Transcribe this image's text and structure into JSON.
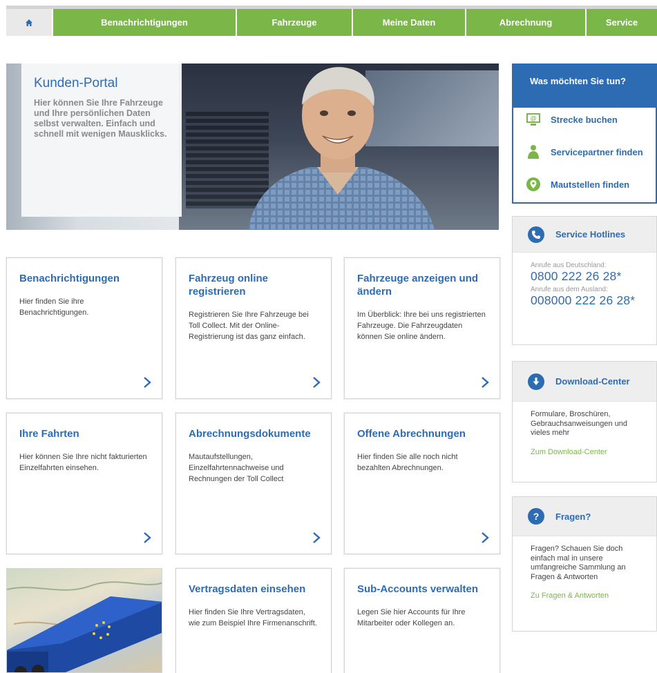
{
  "nav": {
    "items": [
      "Benachrichtigungen",
      "Fahrzeuge",
      "Meine Daten",
      "Abrechnung",
      "Service"
    ]
  },
  "hero": {
    "title": "Kunden-Portal",
    "text": "Hier können Sie Ihre Fahrzeuge und Ihre persönlichen Daten selbst verwalten. Einfach und schnell mit wenigen Mausklicks."
  },
  "tiles": [
    {
      "title": "Benachrichtigungen",
      "text": "Hier finden Sie ihre Benachrichtigungen."
    },
    {
      "title": "Fahrzeug online registrieren",
      "text": "Registrieren Sie Ihre Fahrzeuge bei Toll Collect. Mit der Online-Registrierung ist das ganz einfach."
    },
    {
      "title": "Fahrzeuge anzeigen und ändern",
      "text": "Im Überblick: Ihre bei uns registrierten Fahrzeuge. Die Fahrzeugdaten können Sie online ändern."
    },
    {
      "title": "Ihre Fahrten",
      "text": "Hier können Sie Ihre nicht fakturierten Einzelfahrten einsehen."
    },
    {
      "title": "Abrechnungsdokumente",
      "text": "Mautaufstellungen, Einzelfahrtennachweise und Rechnungen der Toll Collect"
    },
    {
      "title": "Offene Abrechnungen",
      "text": "Hier finden Sie alle noch nicht bezahlten Abrechnungen."
    },
    {
      "title": "Vertragsdaten einsehen",
      "text": "Hier finden Sie Ihre Vertragsdaten, wie zum Beispiel Ihre Firmenanschrift."
    },
    {
      "title": "Sub-Accounts verwalten",
      "text": "Legen Sie hier Accounts für Ihre Mitarbeiter oder Kollegen an."
    }
  ],
  "sidebar": {
    "wmst_title": "Was möchten Sie tun?",
    "actions": [
      "Strecke buchen",
      "Servicepartner finden",
      "Mautstellen finden"
    ],
    "hotlines": {
      "title": "Service Hotlines",
      "de_label": "Anrufe aus Deutschland:",
      "de_number": "0800 222 26 28*",
      "intl_label": "Anrufe aus dem Ausland:",
      "intl_number": "008000 222 26 28*"
    },
    "download": {
      "title": "Download-Center",
      "text": "Formulare, Broschüren, Gebrauchsanweisungen und vieles mehr",
      "link": "Zum Download-Center"
    },
    "faq": {
      "title": "Fragen?",
      "icon_text": "?",
      "text": "Fragen? Schauen Sie doch einfach mal in unsere umfangreiche Sammlung an Fragen & Antworten",
      "link": "Zu Fragen & Antworten"
    }
  },
  "colors": {
    "accent": "#2d6cb3",
    "green": "#7ab648"
  },
  "icons": {
    "home": "home-icon",
    "arrow": "chevron-right-icon",
    "action1": "monitor-at-icon",
    "action2": "person-icon",
    "action3": "map-pin-icon",
    "hotline": "phone-icon",
    "download": "download-icon",
    "faq": "question-icon"
  }
}
